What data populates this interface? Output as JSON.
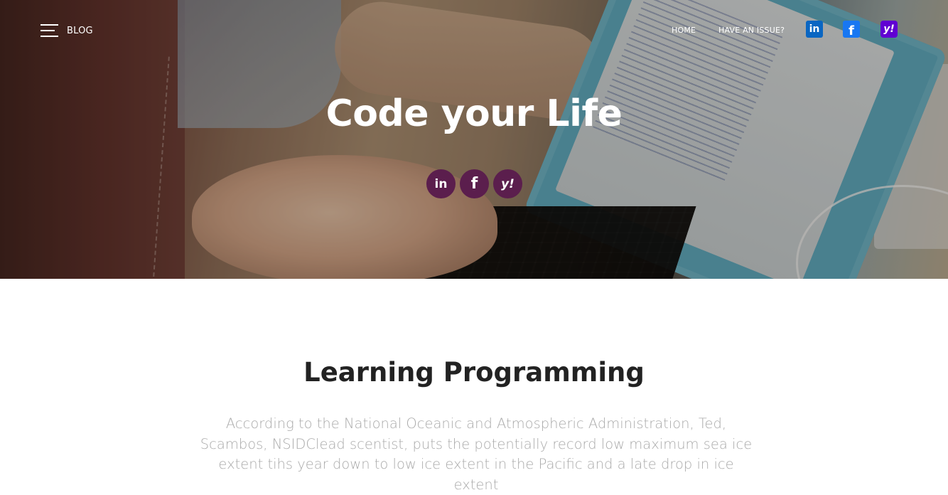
{
  "header": {
    "menu_label": "BLOG",
    "nav": {
      "home_label": "HOME",
      "issue_label": "HAVE AN ISSUE?",
      "icons": [
        "linkedin-icon",
        "facebook-icon",
        "yahoo-icon"
      ]
    }
  },
  "hero": {
    "title": "Code your Life",
    "social": [
      "linkedin-icon",
      "facebook-icon",
      "yahoo-icon"
    ],
    "glyphs": {
      "linkedin": "in",
      "facebook": "f",
      "yahoo": "y!"
    }
  },
  "section": {
    "title": "Learning Programming",
    "text": "According to the National Oceanic and Atmospheric Administration, Ted, Scambos, NSIDClead scentist, puts the potentially record low maximum sea ice extent tihs year down to low ice extent in the Pacific and a late drop in ice extent"
  },
  "colors": {
    "social_circle": "#5b1e4d",
    "linkedin": "#0a66c2",
    "facebook": "#1877f2",
    "yahoo": "#6001d2",
    "heading": "#222222",
    "body_text": "#aaaaaa"
  }
}
